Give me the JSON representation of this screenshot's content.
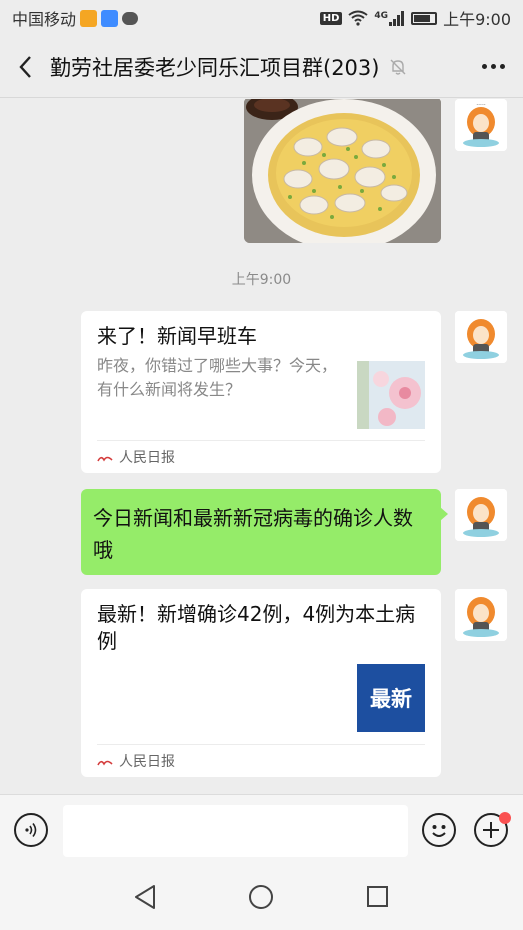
{
  "status_bar": {
    "carrier": "中国移动",
    "network_label": "4G",
    "hd_label": "HD",
    "time": "上午9:00"
  },
  "header": {
    "title": "勤劳社居委老少同乐汇项目群(203)"
  },
  "messages": {
    "timestamp": "上午9:00",
    "card1": {
      "title": "来了！新闻早班车",
      "description": "昨夜，你错过了哪些大事？今天，有什么新闻将发生？",
      "source": "人民日报"
    },
    "text_message": {
      "text": "今日新闻和最新新冠病毒的确诊人数哦"
    },
    "card2": {
      "title": "最新！新增确诊42例，4例为本土病例",
      "thumb_text": "最新",
      "source": "人民日报"
    }
  },
  "icons": {
    "back": "chevron-left-icon",
    "mute": "bell-off-icon",
    "more": "more-dots-icon",
    "voice": "voice-icon",
    "emoji": "emoji-icon",
    "plus": "plus-icon"
  },
  "colors": {
    "background": "#ededed",
    "own_bubble": "#95ec69",
    "card": "#ffffff",
    "latest_thumb": "#1d4fa0",
    "notification_dot": "#fa5151"
  }
}
